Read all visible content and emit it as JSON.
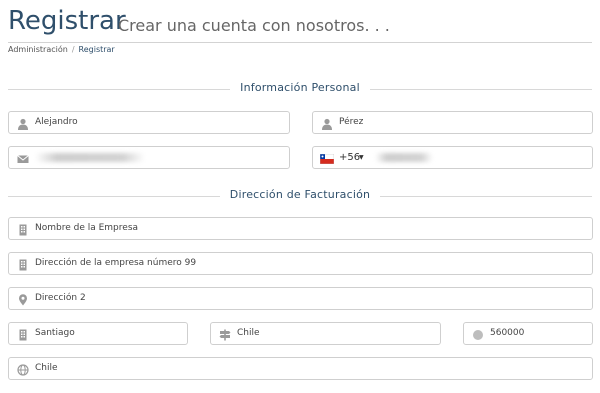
{
  "header": {
    "title": "Registrar",
    "subtitle": "Crear una cuenta con nosotros. . ."
  },
  "breadcrumb": {
    "items": [
      "Administración",
      "Registrar"
    ]
  },
  "sections": {
    "personal": "Información Personal",
    "billing": "Dirección de Facturación"
  },
  "form": {
    "first_name": "Alejandro",
    "last_name": "Pérez",
    "phone_country_code": "+56",
    "company": "Nombre de la Empresa",
    "address1": "Dirección de la empresa número 99",
    "address2": "Dirección 2",
    "city": "Santiago",
    "state": "Chile",
    "postcode": "560000",
    "country": "Chile"
  },
  "icons": {
    "person": "user-icon",
    "email": "envelope-icon",
    "building": "building-icon",
    "location": "map-marker-icon",
    "signpost": "signpost-icon",
    "postcode": "circle-icon",
    "globe": "globe-icon",
    "flag": "chile-flag-icon"
  },
  "colors": {
    "heading": "#2f4f6b",
    "border": "#cfcfcf",
    "icon": "#9a9a9a"
  }
}
